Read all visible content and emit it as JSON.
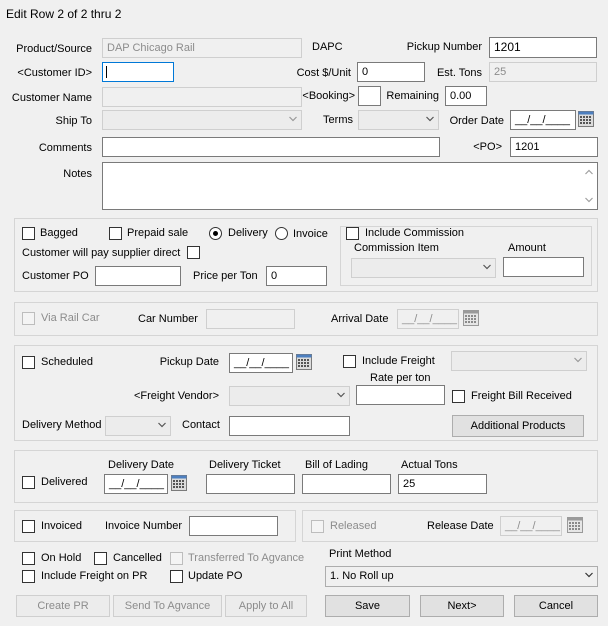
{
  "window": {
    "title": "Edit Row 2 of 2 thru 2"
  },
  "header": {
    "product_source_label": "Product/Source",
    "product_source_value": "DAP Chicago Rail",
    "dapc_label": "DAPC",
    "pickup_number_label": "Pickup Number",
    "pickup_number_value": "1201",
    "customer_id_label": "<Customer ID>",
    "customer_id_value": "",
    "cost_unit_label": "Cost $/Unit",
    "cost_unit_value": "0",
    "est_tons_label": "Est. Tons",
    "est_tons_value": "25",
    "customer_name_label": "Customer Name",
    "customer_name_value": "",
    "booking_label": "<Booking>",
    "booking_value": "",
    "remaining_label": "Remaining",
    "remaining_value": "0.00",
    "ship_to_label": "Ship To",
    "ship_to_value": "",
    "terms_label": "Terms",
    "terms_value": "",
    "order_date_label": "Order Date",
    "order_date_value": "__/__/____",
    "comments_label": "Comments",
    "comments_value": "",
    "po_label": "<PO>",
    "po_value": "1201",
    "notes_label": "Notes",
    "notes_value": ""
  },
  "sale": {
    "bagged_label": "Bagged",
    "prepaid_label": "Prepaid sale",
    "delivery_label": "Delivery",
    "invoice_label": "Invoice",
    "pay_supplier_label": "Customer will pay supplier direct",
    "customer_po_label": "Customer PO",
    "customer_po_value": "",
    "price_per_ton_label": "Price per Ton",
    "price_per_ton_value": "0",
    "include_commission_label": "Include Commission",
    "commission_item_label": "Commission Item",
    "commission_item_value": "",
    "amount_label": "Amount",
    "amount_value": ""
  },
  "rail": {
    "via_rail_car_label": "Via Rail Car",
    "car_number_label": "Car Number",
    "car_number_value": "",
    "arrival_date_label": "Arrival Date",
    "arrival_date_value": "__/__/____"
  },
  "freight": {
    "scheduled_label": "Scheduled",
    "pickup_date_label": "Pickup Date",
    "pickup_date_value": "__/__/____",
    "include_freight_label": "Include Freight",
    "include_freight_value": "",
    "rate_per_ton_label": "Rate per ton",
    "rate_per_ton_value": "",
    "freight_vendor_label": "<Freight Vendor>",
    "freight_vendor_value": "",
    "freight_bill_label": "Freight Bill Received",
    "delivery_method_label": "Delivery Method",
    "delivery_method_value": "",
    "contact_label": "Contact",
    "contact_value": "",
    "additional_products_label": "Additional Products"
  },
  "delivered": {
    "delivered_label": "Delivered",
    "delivery_date_label": "Delivery Date",
    "delivery_date_value": "__/__/____",
    "delivery_ticket_label": "Delivery Ticket",
    "delivery_ticket_value": "",
    "bill_of_lading_label": "Bill of Lading",
    "bill_of_lading_value": "",
    "actual_tons_label": "Actual Tons",
    "actual_tons_value": "25"
  },
  "invoice": {
    "invoiced_label": "Invoiced",
    "invoice_number_label": "Invoice Number",
    "invoice_number_value": "",
    "released_label": "Released",
    "release_date_label": "Release Date",
    "release_date_value": "__/__/____"
  },
  "footer": {
    "on_hold_label": "On Hold",
    "cancelled_label": "Cancelled",
    "transferred_label": "Transferred To Agvance",
    "include_freight_pr_label": "Include Freight on PR",
    "update_po_label": "Update PO",
    "print_method_label": "Print Method",
    "print_method_value": "1. No Roll up"
  },
  "buttons": {
    "create_pr": "Create PR",
    "send_to_agvance": "Send To Agvance",
    "apply_to_all": "Apply to All",
    "save": "Save",
    "next": "Next>",
    "cancel": "Cancel"
  }
}
